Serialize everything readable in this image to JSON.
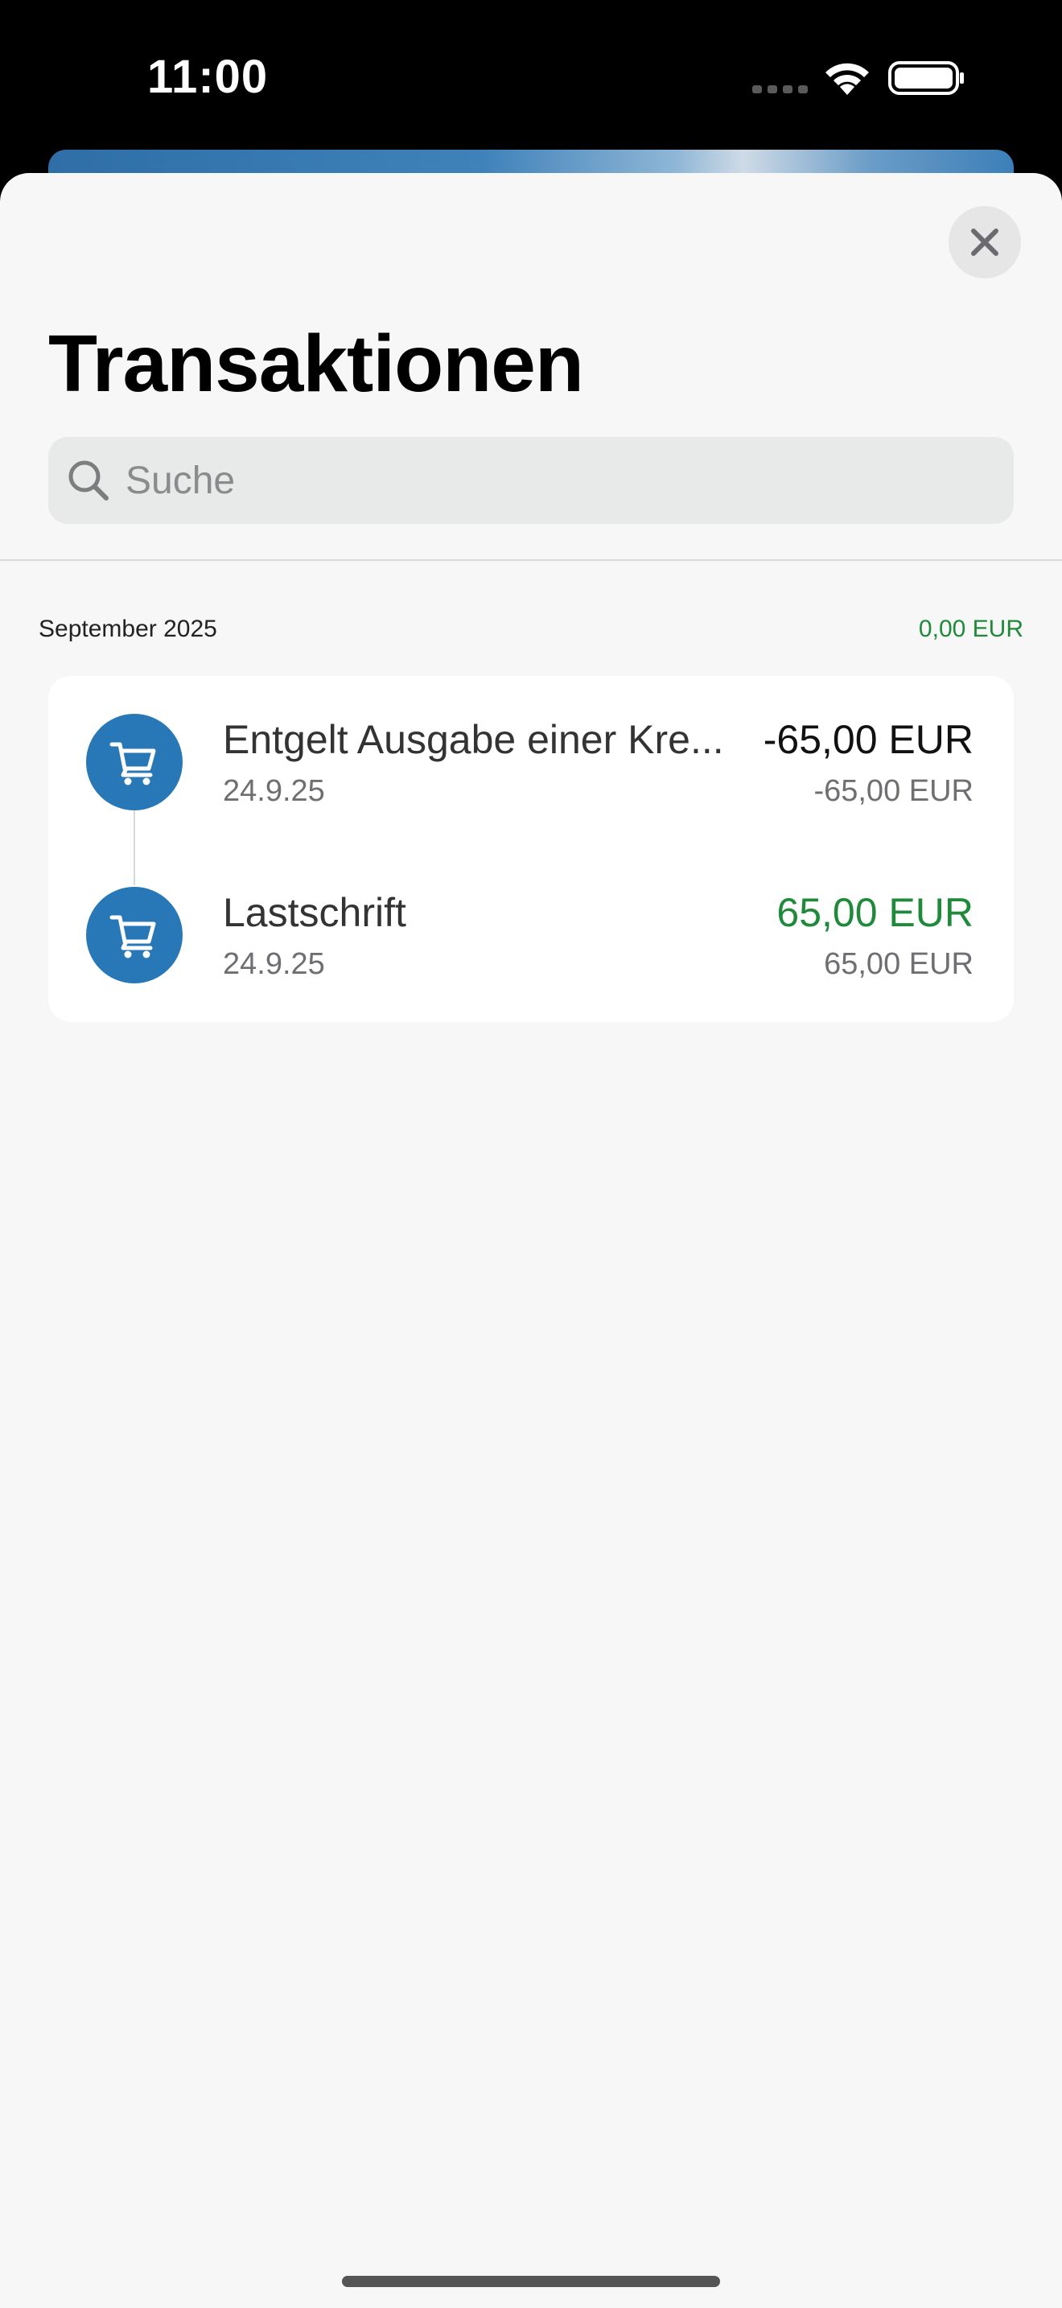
{
  "status_bar": {
    "time": "11:00"
  },
  "header": {
    "title": "Transaktionen",
    "close_icon": "close-icon"
  },
  "search": {
    "placeholder": "Suche",
    "value": "",
    "icon": "search-icon"
  },
  "section": {
    "title": "September 2025",
    "total": "0,00 EUR",
    "total_color": "#1f8a3a"
  },
  "transactions": [
    {
      "title": "Entgelt Ausgabe einer Kre...",
      "date": "24.9.25",
      "amount": "-65,00 EUR",
      "sub_amount": "-65,00 EUR",
      "icon": "shopping-cart-icon",
      "amount_color": "#111111"
    },
    {
      "title": "Lastschrift",
      "date": "24.9.25",
      "amount": "65,00 EUR",
      "sub_amount": "65,00 EUR",
      "icon": "shopping-cart-icon",
      "amount_color": "#1f8a3a"
    }
  ],
  "colors": {
    "accent": "#2878b8",
    "positive": "#1f8a3a",
    "sheet_background": "#f7f7f7"
  }
}
